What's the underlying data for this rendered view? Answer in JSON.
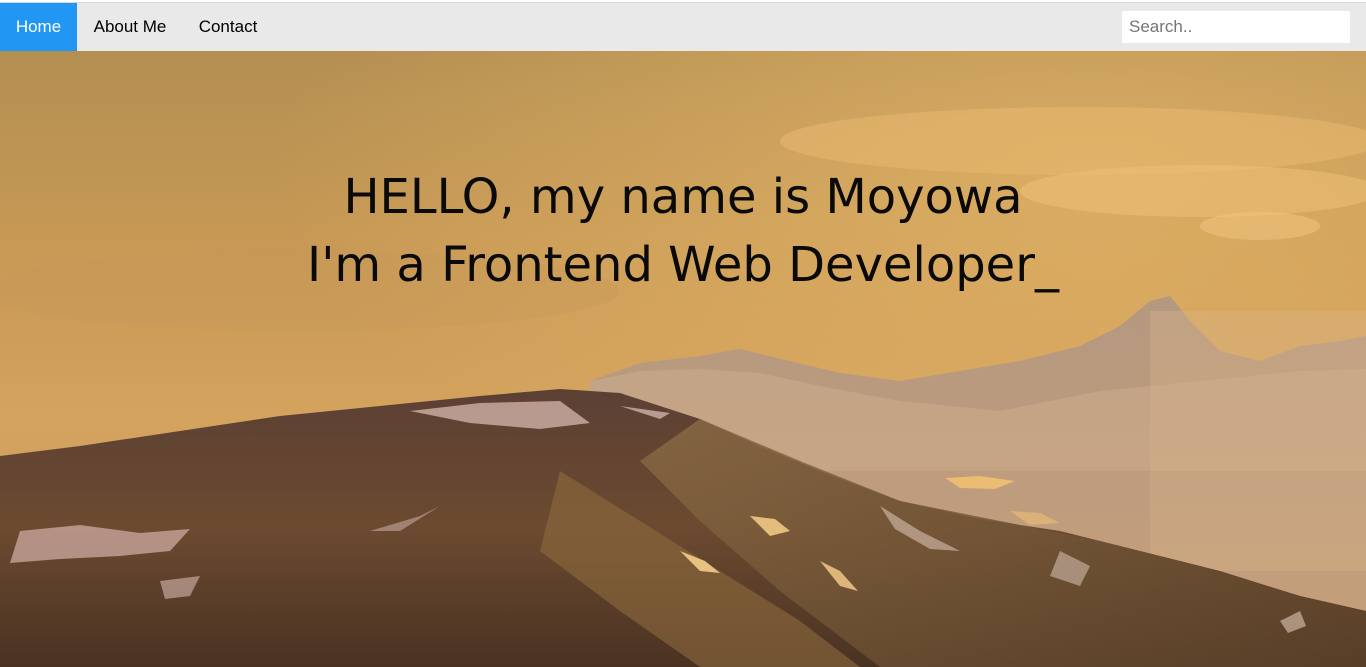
{
  "nav": {
    "items": [
      {
        "label": "Home",
        "active": true
      },
      {
        "label": "About Me",
        "active": false
      },
      {
        "label": "Contact",
        "active": false
      }
    ],
    "search_placeholder": "Search..",
    "active_color": "#2196F3",
    "bar_color": "#e9e9e9"
  },
  "hero": {
    "line1": "HELLO, my name is Moyowa",
    "line2": "I'm a Frontend Web Developer_",
    "background": "mountain-landscape-sunset-photo"
  }
}
